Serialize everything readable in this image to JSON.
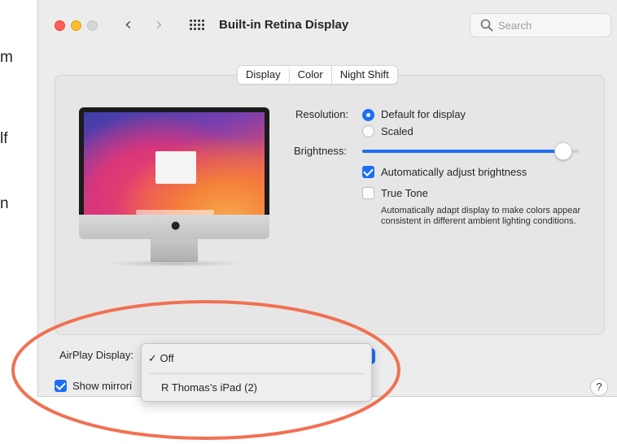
{
  "background_doc": {
    "fragments": [
      "m",
      "lf",
      "n"
    ]
  },
  "window": {
    "title": "Built-in Retina Display",
    "nav_back": "‹",
    "nav_forward": "›",
    "search_placeholder": "Search"
  },
  "tabs": [
    {
      "label": "Display",
      "active": true
    },
    {
      "label": "Color",
      "active": false
    },
    {
      "label": "Night Shift",
      "active": false
    }
  ],
  "resolution": {
    "label": "Resolution:",
    "options": [
      {
        "label": "Default for display",
        "selected": true
      },
      {
        "label": "Scaled",
        "selected": false
      }
    ]
  },
  "brightness": {
    "label": "Brightness:",
    "level": 0.93
  },
  "auto_brightness": {
    "label": "Automatically adjust brightness",
    "checked": true
  },
  "true_tone": {
    "label": "True Tone",
    "checked": false,
    "description": "Automatically adapt display to make colors appear consistent in different ambient lighting conditions."
  },
  "airplay": {
    "label": "AirPlay Display:",
    "menu_items": [
      {
        "label": "Off",
        "checked": true
      },
      {
        "label": "R Thomas’s iPad (2)",
        "checked": false
      }
    ],
    "check_glyph": "✓"
  },
  "mirroring": {
    "label": "Show mirrori",
    "checked": true
  },
  "help": {
    "label": "?"
  },
  "colors": {
    "accent": "#1c6ff2",
    "annotation": "#f07152"
  }
}
